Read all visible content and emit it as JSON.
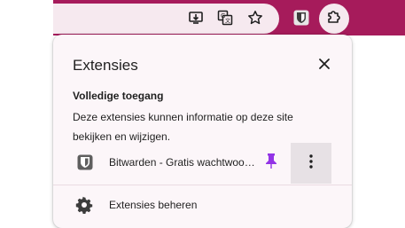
{
  "toolbar": {
    "icons": [
      "install-app-icon",
      "translate-icon",
      "bookmark-star-icon",
      "bitwarden-icon",
      "extensions-puzzle-icon"
    ],
    "accent_color": "#a61b5b"
  },
  "popup": {
    "title": "Extensies",
    "section_title": "Volledige toegang",
    "section_description": "Deze extensies kunnen informatie op deze site bekijken en wijzigen.",
    "extensions": [
      {
        "name": "Bitwarden - Gratis wachtwoordbeheerder",
        "icon": "bitwarden-icon",
        "pinned": true,
        "pin_color": "#9334e6"
      }
    ],
    "manage_label": "Extensies beheren"
  }
}
